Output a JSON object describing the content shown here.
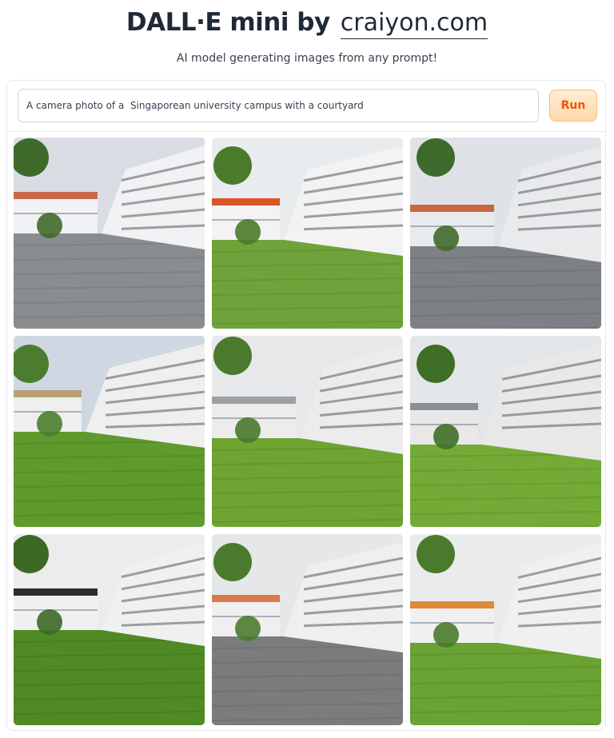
{
  "header": {
    "title": "DALL·E mini by",
    "site_link": "craiyon.com",
    "subtitle": "AI model generating images from any prompt!"
  },
  "prompt": {
    "value": "A camera photo of a  Singaporean university campus with a courtyard"
  },
  "run_button": {
    "label": "Run"
  },
  "results": {
    "count": 9,
    "images": [
      {
        "scene": "paved-plaza",
        "sky": "#d9dde3",
        "ground": "#8a8d90",
        "building": "#f1f2f3",
        "accent": "#c96a4a",
        "tree": "#3f6b2a"
      },
      {
        "scene": "lawn-curved-building",
        "sky": "#e8ecef",
        "ground": "#6fa33a",
        "building": "#f3f3f3",
        "accent": "#d9552a",
        "tree": "#4b7a2a"
      },
      {
        "scene": "paved-walkway",
        "sky": "#dfe3e8",
        "ground": "#7d8084",
        "building": "#e9eaec",
        "accent": "#c9683e",
        "tree": "#3e6a2c"
      },
      {
        "scene": "lawn-courtyard-path",
        "sky": "#cfd8e2",
        "ground": "#5f9a2c",
        "building": "#efefef",
        "accent": "#b9a074",
        "tree": "#4c7d2e"
      },
      {
        "scene": "lawn-courtyard",
        "sky": "#e6e8ea",
        "ground": "#6ea431",
        "building": "#ececec",
        "accent": "#9aa0a6",
        "tree": "#4a7a2d"
      },
      {
        "scene": "lawn-tree",
        "sky": "#e3e6e9",
        "ground": "#74ab36",
        "building": "#e8e8e8",
        "accent": "#8a8f94",
        "tree": "#3f6f27"
      },
      {
        "scene": "lawn-shadow",
        "sky": "#ececec",
        "ground": "#4f8a24",
        "building": "#f0f0f0",
        "accent": "#2d2d2d",
        "tree": "#3b6a25"
      },
      {
        "scene": "paved-curve",
        "sky": "#e5e7e9",
        "ground": "#7a7c7e",
        "building": "#efefef",
        "accent": "#d97a4a",
        "tree": "#4b7c2d"
      },
      {
        "scene": "lawn-tower",
        "sky": "#e9ebed",
        "ground": "#6aa233",
        "building": "#f0f0f0",
        "accent": "#d98a3a",
        "tree": "#4a7a2b"
      }
    ]
  }
}
